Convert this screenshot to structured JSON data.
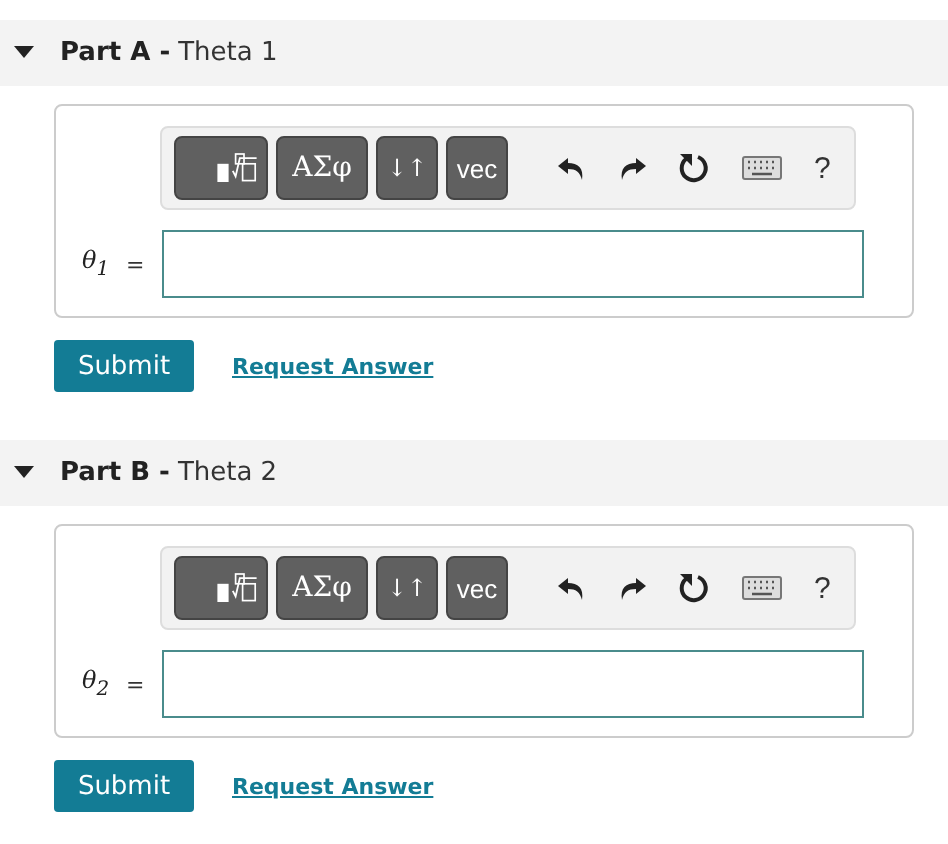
{
  "parts": [
    {
      "label": "Part A -",
      "title": "Theta 1",
      "expanded": true,
      "toolbar": {
        "symbols": "AΣφ",
        "arrows": "↓↑",
        "vector": "vec",
        "help": "?"
      },
      "variable": "θ$_{1}$",
      "equals": "=",
      "submit": "Submit",
      "request": "Request Answer"
    },
    {
      "label": "Part B -",
      "title": "Theta 2",
      "expanded": true,
      "toolbar": {
        "symbols": "AΣφ",
        "arrows": "↓↑",
        "vector": "vec",
        "help": "?"
      },
      "variable": "θ$_{2}$",
      "equals": "=",
      "submit": "Submit",
      "request": "Request Answer"
    }
  ]
}
